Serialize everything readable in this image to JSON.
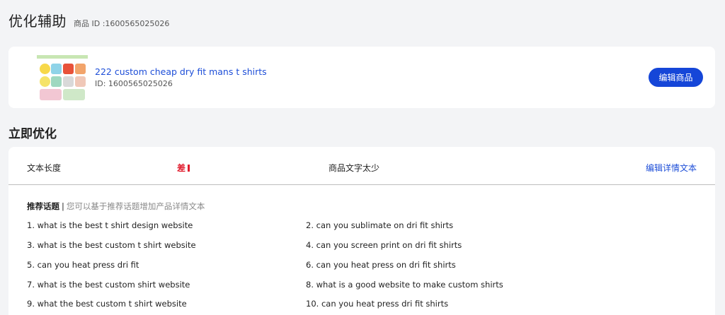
{
  "header": {
    "title": "优化辅助",
    "product_id_label": "商品 ID :1600565025026"
  },
  "product": {
    "name": "222 custom cheap dry fit mans t shirts",
    "id_text": "ID: 1600565025026",
    "edit_button_label": "编辑商品"
  },
  "optimize": {
    "section_title": "立即优化",
    "metric": {
      "label": "文本长度",
      "rating": "差",
      "description": "商品文字太少",
      "action_label": "编辑详情文本"
    },
    "topics_heading": "推荐话题",
    "topics_separator": "|",
    "topics_hint": "您可以基于推荐话题增加产品详情文本",
    "topics": [
      "1. what is the best t shirt design website",
      "2. can you sublimate on dri fit shirts",
      "3. what is the best custom t shirt website",
      "4. can you screen print on dri fit shirts",
      "5. can you heat press dri fit",
      "6. can you heat press on dri fit shirts",
      "7. what is the best custom shirt website",
      "8. what is a good website to make custom shirts",
      "9. what the best custom t shirt website",
      "10. can you heat press dri fit shirts"
    ]
  },
  "colors": {
    "accent": "#1546d8",
    "link": "#1d4ed8",
    "danger": "#e11d2e",
    "background": "#f3f4f6"
  }
}
